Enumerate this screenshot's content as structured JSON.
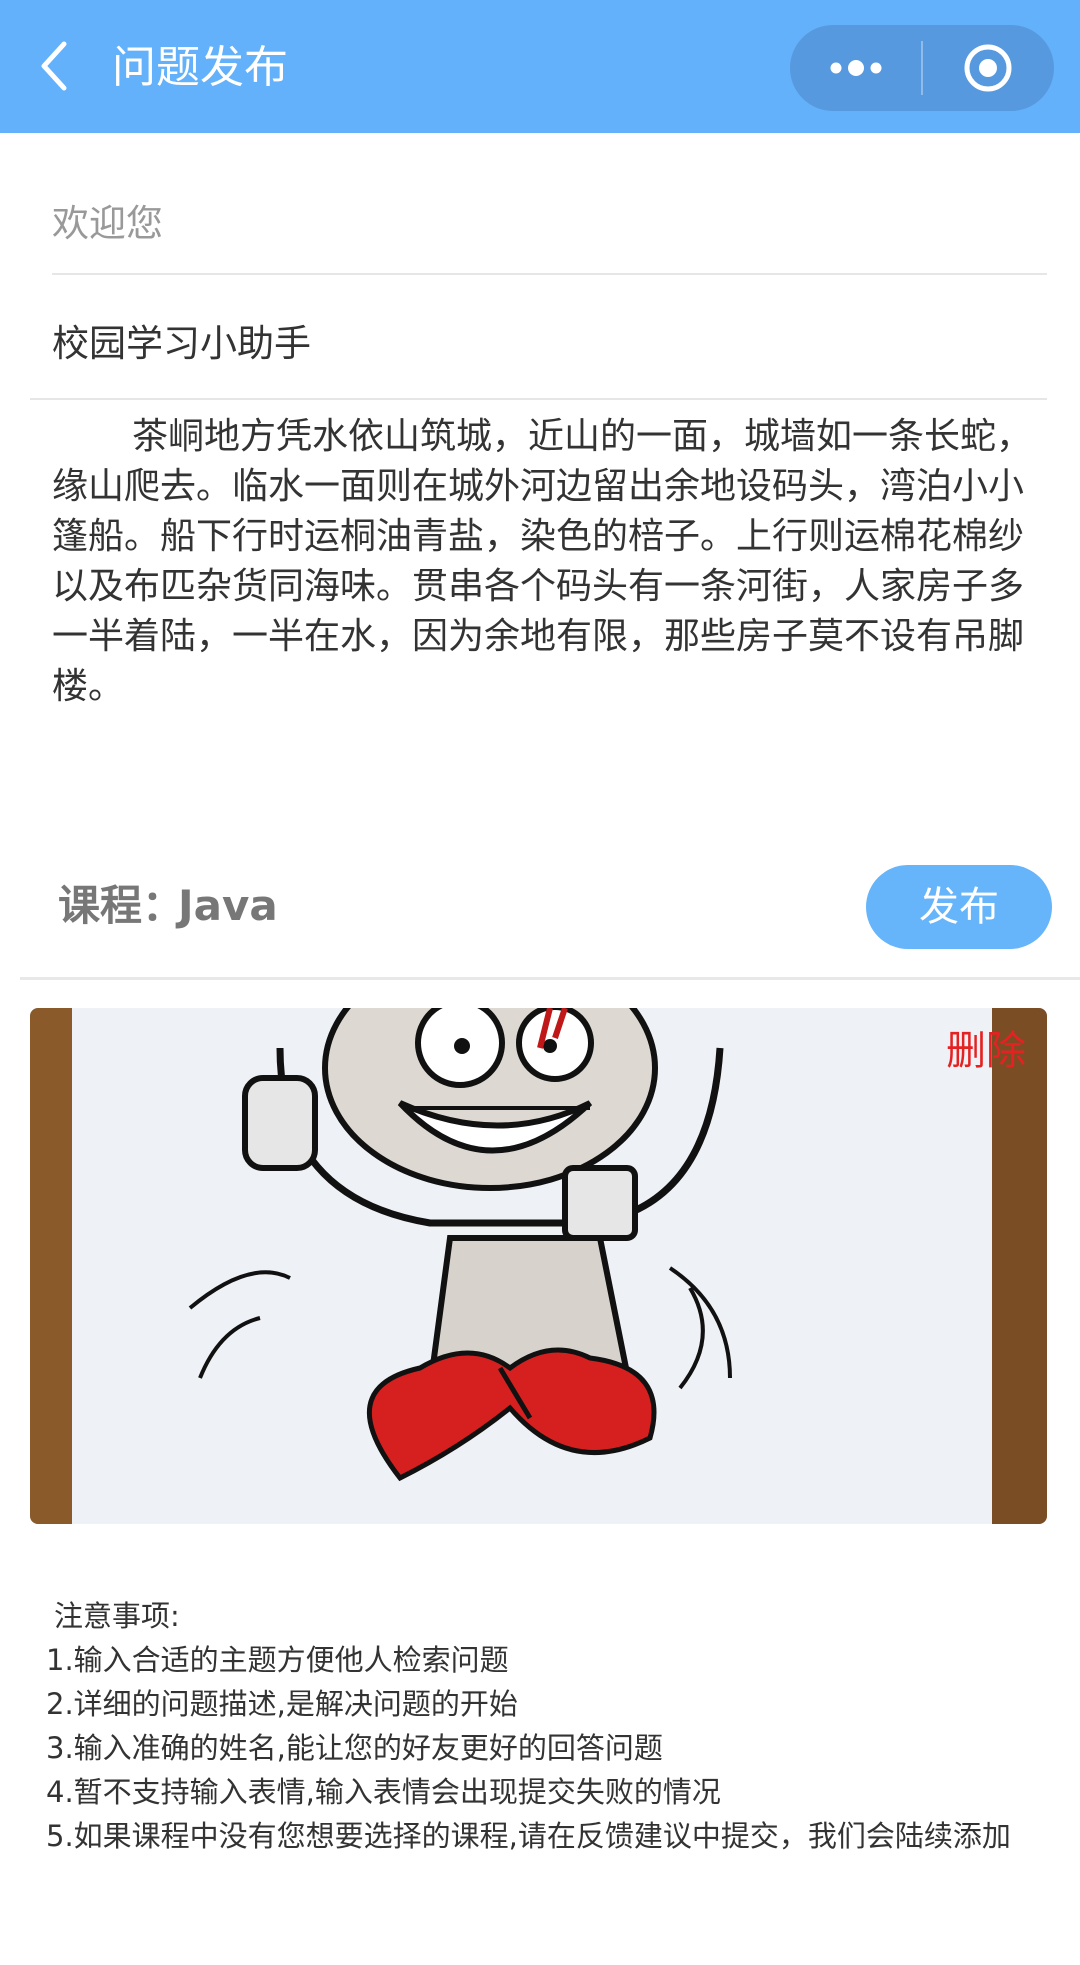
{
  "header": {
    "title": "问题发布",
    "background": "#62b1fa"
  },
  "form": {
    "welcome_text": "欢迎您",
    "subject": "校园学习小助手",
    "description": "茶峒地方凭水依山筑城，近山的一面，城墙如一条长蛇，缘山爬去。临水一面则在城外河边留出余地设码头，湾泊小小篷船。船下行时运桐油青盐，染色的棓子。上行则运棉花棉纱以及布匹杂货同海味。贯串各个码头有一条河街，人家房子多一半着陆，一半在水，因为余地有限，那些房子莫不设有吊脚楼。",
    "course_label": "课程：",
    "course_value": "Java",
    "publish_label": "发布",
    "delete_label": "删除"
  },
  "notes": {
    "title": "注意事项:",
    "items": [
      "1.输入合适的主题方便他人检索问题",
      "2.详细的问题描述,是解决问题的开始",
      "3.输入准确的姓名,能让您的好友更好的回答问题",
      "4.暂不支持输入表情,输入表情会出现提交失败的情况",
      "5.如果课程中没有您想要选择的课程,请在反馈建议中提交，我们会陆续添加"
    ]
  },
  "colors": {
    "accent": "#66b4fa",
    "delete": "#e52222"
  },
  "icons": {
    "back": "chevron-left-icon",
    "more": "more-dots-icon",
    "close": "target-circle-icon"
  }
}
